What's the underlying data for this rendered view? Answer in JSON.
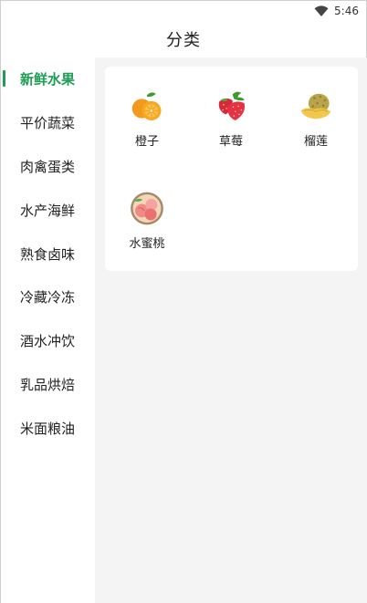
{
  "status_bar": {
    "time": "5:46",
    "wifi_icon": "wifi-icon"
  },
  "header": {
    "title": "分类"
  },
  "sidebar": {
    "active_color": "#1f9d55",
    "items": [
      {
        "label": "新鲜水果",
        "active": true
      },
      {
        "label": "平价蔬菜",
        "active": false
      },
      {
        "label": "肉禽蛋类",
        "active": false
      },
      {
        "label": "水产海鲜",
        "active": false
      },
      {
        "label": "熟食卤味",
        "active": false
      },
      {
        "label": "冷藏冷冻",
        "active": false
      },
      {
        "label": "酒水冲饮",
        "active": false
      },
      {
        "label": "乳品烘焙",
        "active": false
      },
      {
        "label": "米面粮油",
        "active": false
      }
    ]
  },
  "products": [
    {
      "name": "橙子",
      "icon": "orange-icon"
    },
    {
      "name": "草莓",
      "icon": "strawberry-icon"
    },
    {
      "name": "榴莲",
      "icon": "durian-icon"
    },
    {
      "name": "水蜜桃",
      "icon": "peach-icon"
    }
  ]
}
